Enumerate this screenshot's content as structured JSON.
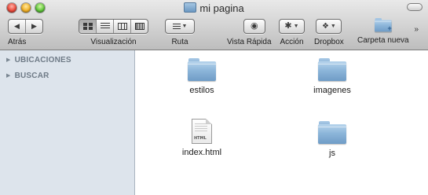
{
  "window": {
    "title": "mi pagina"
  },
  "toolbar": {
    "back_label": "Atrás",
    "view_label": "Visualización",
    "arrange_label": "Ruta",
    "quicklook_label": "Vista Rápida",
    "action_label": "Acción",
    "dropbox_label": "Dropbox",
    "newfolder_label": "Carpeta nueva"
  },
  "sidebar": {
    "sections": [
      {
        "label": "UBICACIONES"
      },
      {
        "label": "BUSCAR"
      }
    ]
  },
  "content": {
    "items": [
      {
        "name": "estilos",
        "kind": "folder"
      },
      {
        "name": "imagenes",
        "kind": "folder"
      },
      {
        "name": "index.html",
        "kind": "html-file",
        "tag": "HTML"
      },
      {
        "name": "js",
        "kind": "folder"
      }
    ]
  },
  "colors": {
    "sidebar_bg": "#dde4ec",
    "folder_blue": "#8db6da"
  }
}
